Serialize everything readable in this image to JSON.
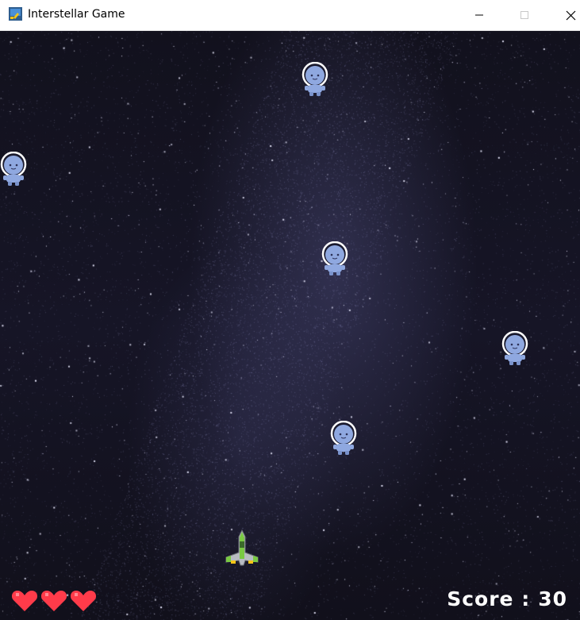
{
  "window": {
    "title": "Interstellar Game"
  },
  "hud": {
    "score_label": "Score :",
    "score_value": "30",
    "lives": 3
  },
  "player": {
    "sprite": "spaceship-icon"
  },
  "enemies": {
    "sprite": "alien-astronaut-icon",
    "count": 5
  },
  "colors": {
    "background": "#14131f",
    "heart": "#ff3b4a",
    "alien_body": "#8fa8e0",
    "ship_body": "#7ac943"
  }
}
